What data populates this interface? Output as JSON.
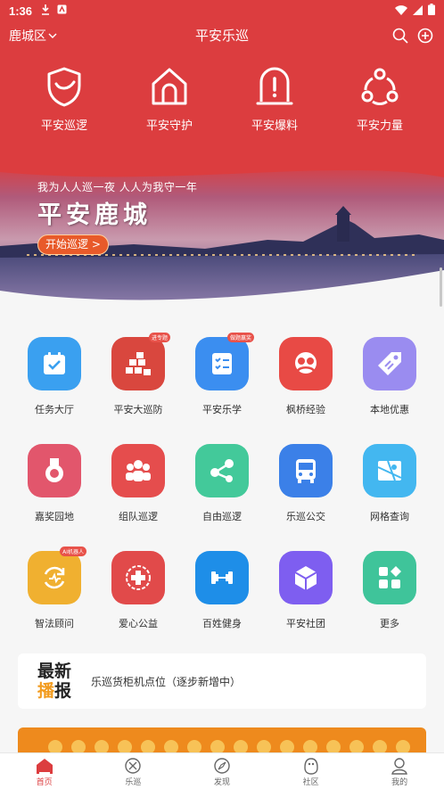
{
  "status_bar": {
    "time": "1:36"
  },
  "header": {
    "district": "鹿城区",
    "title": "平安乐巡"
  },
  "hero": [
    {
      "label": "平安巡逻",
      "icon": "shield-icon"
    },
    {
      "label": "平安守护",
      "icon": "house-icon"
    },
    {
      "label": "平安爆料",
      "icon": "alert-tombstone-icon"
    },
    {
      "label": "平安力量",
      "icon": "network-icon"
    }
  ],
  "banner": {
    "slogan": "我为人人巡一夜 人人为我守一年",
    "title": "平安鹿城",
    "button": "开始巡逻 >"
  },
  "grid": [
    {
      "label": "任务大厅",
      "color": "#3aa0f0",
      "icon": "calendar-check-icon",
      "badge": ""
    },
    {
      "label": "平安大巡防",
      "color": "#d9473e",
      "icon": "blocks-icon",
      "badge": "进专题"
    },
    {
      "label": "平安乐学",
      "color": "#3b8ef0",
      "icon": "checklist-icon",
      "badge": "做题赢奖"
    },
    {
      "label": "枫桥经验",
      "color": "#e84a45",
      "icon": "portrait-icon",
      "badge": ""
    },
    {
      "label": "本地优惠",
      "color": "#9a8cf0",
      "icon": "tag-icon",
      "badge": ""
    },
    {
      "label": "嘉奖园地",
      "color": "#e2566c",
      "icon": "medal-icon",
      "badge": ""
    },
    {
      "label": "组队巡逻",
      "color": "#e54d4d",
      "icon": "team-icon",
      "badge": ""
    },
    {
      "label": "自由巡逻",
      "color": "#43c99a",
      "icon": "share-nodes-icon",
      "badge": ""
    },
    {
      "label": "乐巡公交",
      "color": "#3b80e8",
      "icon": "bus-icon",
      "badge": ""
    },
    {
      "label": "网格查询",
      "color": "#43b7f0",
      "icon": "map-icon",
      "badge": ""
    },
    {
      "label": "智法顾问",
      "color": "#f0b030",
      "icon": "refresh-pulse-icon",
      "badge": "AI机器人"
    },
    {
      "label": "爱心公益",
      "color": "#e14a4a",
      "icon": "red-cross-icon",
      "badge": ""
    },
    {
      "label": "百姓健身",
      "color": "#1e8ee8",
      "icon": "dumbbell-icon",
      "badge": ""
    },
    {
      "label": "平安社团",
      "color": "#7e5ef0",
      "icon": "cube-icon",
      "badge": ""
    },
    {
      "label": "更多",
      "color": "#3fc49a",
      "icon": "apps-icon",
      "badge": ""
    }
  ],
  "news": {
    "tag_line1": "最新",
    "tag_line2a": "播",
    "tag_line2b": "报",
    "text": "乐巡货柜机点位（逐步新增中）"
  },
  "tabs": [
    {
      "label": "首页",
      "icon": "home-icon",
      "active": true
    },
    {
      "label": "乐巡",
      "icon": "patrol-icon",
      "active": false
    },
    {
      "label": "发现",
      "icon": "compass-icon",
      "active": false
    },
    {
      "label": "社区",
      "icon": "community-icon",
      "active": false
    },
    {
      "label": "我的",
      "icon": "user-icon",
      "active": false
    }
  ],
  "colors": {
    "primary_red": "#dc3d3f",
    "news_accent": "#f29b1e"
  }
}
